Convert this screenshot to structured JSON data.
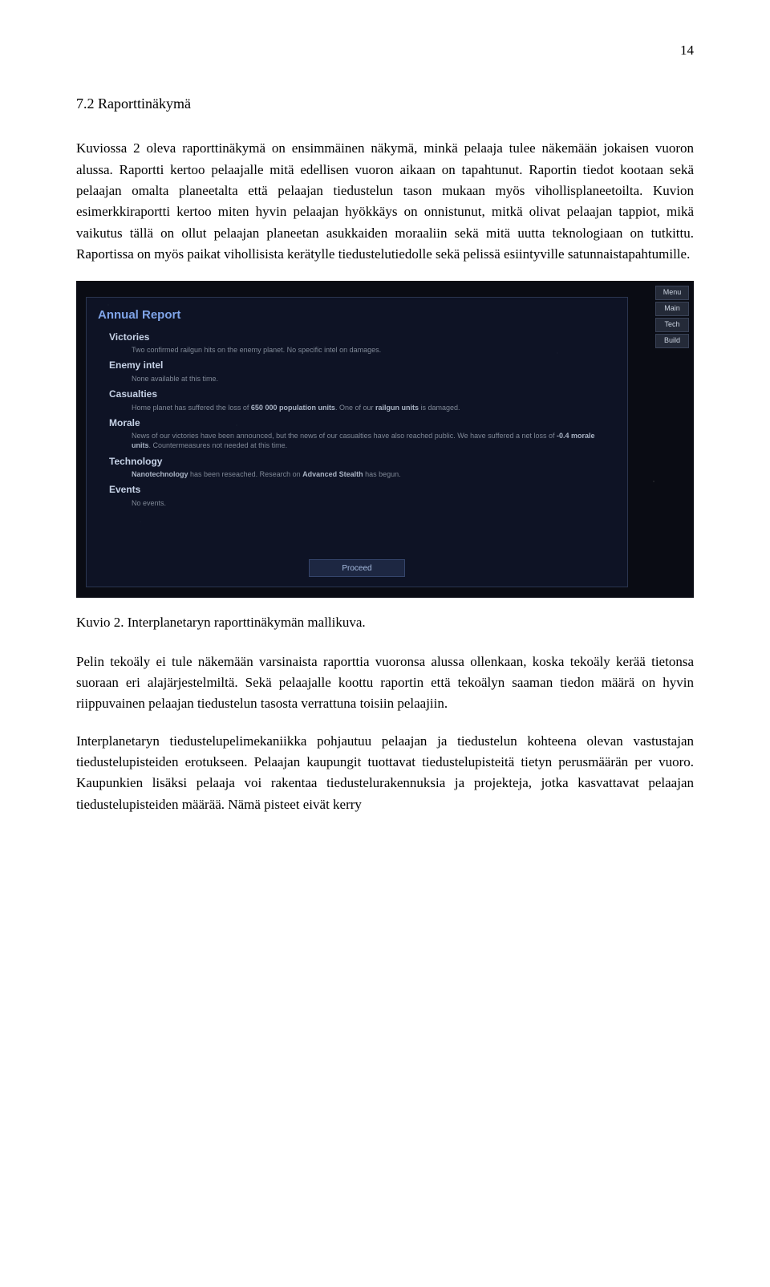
{
  "page_number": "14",
  "heading": "7.2 Raporttinäkymä",
  "para1": "Kuviossa 2 oleva raporttinäkymä on ensimmäinen näkymä, minkä pelaaja tulee näkemään jokaisen vuoron alussa. Raportti kertoo pelaajalle mitä edellisen vuoron aikaan on tapahtunut. Raportin tiedot kootaan sekä pelaajan omalta planeetalta että pelaajan tiedustelun tason mukaan myös vihollisplaneetoilta. Kuvion esimerkkiraportti kertoo miten hyvin pelaajan hyökkäys on onnistunut, mitkä olivat pelaajan tappiot, mikä vaikutus tällä on ollut pelaajan planeetan asukkaiden moraaliin sekä mitä uutta teknologiaan on tutkittu. Raportissa on myös paikat vihollisista kerätylle tiedustelutiedolle sekä pelissä esiintyville satunnaistapahtumille.",
  "caption": "Kuvio 2. Interplanetaryn raporttinäkymän mallikuva.",
  "para2": "Pelin tekoäly ei tule näkemään varsinaista raporttia vuoronsa alussa ollenkaan, koska tekoäly kerää tietonsa suoraan eri alajärjestelmiltä. Sekä pelaajalle koottu raportin että tekoälyn saaman tiedon määrä on hyvin riippuvainen pelaajan tiedustelun tasosta verrattuna toisiin pelaajiin.",
  "para3": "Interplanetaryn tiedustelupelimekaniikka pohjautuu pelaajan ja tiedustelun kohteena olevan vastustajan tiedustelupisteiden erotukseen. Pelaajan kaupungit tuottavat tiedustelupisteitä tietyn perusmäärän per vuoro. Kaupunkien lisäksi pelaaja voi rakentaa tiedustelurakennuksia ja projekteja, jotka kasvattavat pelaajan tiedustelupisteiden määrää. Nämä pisteet eivät kerry",
  "screenshot": {
    "title": "Annual Report",
    "sections": {
      "victories": {
        "label": "Victories",
        "text": "Two confirmed railgun hits on the enemy planet. No specific intel on damages."
      },
      "intel": {
        "label": "Enemy intel",
        "text": "None available at this time."
      },
      "casualties": {
        "label": "Casualties",
        "text_pre": "Home planet has suffered the loss of ",
        "bold1": "650 000 population units",
        "text_mid": ". One of our ",
        "bold2": "railgun units",
        "text_post": " is damaged."
      },
      "morale": {
        "label": "Morale",
        "text_pre": "News of our victories have been announced, but the news of our casualties have also reached public. We have suffered a net loss of ",
        "bold1": "-0.4 morale units",
        "text_post": ". Countermeasures not needed at this time."
      },
      "technology": {
        "label": "Technology",
        "bold1": "Nanotechnology",
        "text_mid": " has been reseached. Research on ",
        "bold2": "Advanced Stealth",
        "text_post": " has begun."
      },
      "events": {
        "label": "Events",
        "text": "No events."
      }
    },
    "proceed": "Proceed",
    "menu": [
      "Menu",
      "Main",
      "Tech",
      "Build"
    ]
  }
}
